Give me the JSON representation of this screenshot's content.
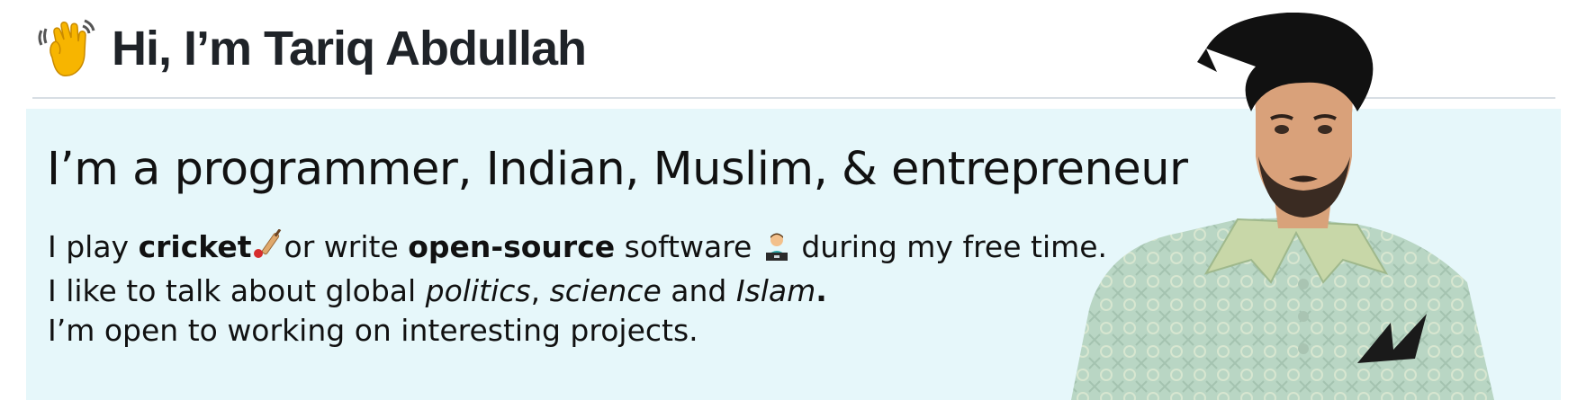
{
  "header": {
    "wave_icon": "waving-hand-icon",
    "title": "Hi, I’m Tariq Abdullah"
  },
  "intro": {
    "headline": "I’m a programmer, Indian, Muslim, & entrepreneur",
    "line1": {
      "part1": "I play ",
      "cricket": "cricket",
      "cricket_icon": "cricket-bat-icon",
      "part2": "or write ",
      "open_source": "open-source",
      "part3": " software ",
      "coder_icon": "technologist-icon",
      "part4": " during my free time."
    },
    "line2": {
      "part1": "I like to talk about global ",
      "politics": "politics",
      "comma": ", ",
      "science": "science",
      "and": " and ",
      "islam": "Islam",
      "period": "."
    },
    "line3": "I’m open to working on interesting projects."
  },
  "photo": {
    "subject": "portrait-photo"
  },
  "colors": {
    "panel_bg": "#e6f7fa",
    "divider": "#d8dee4",
    "title_text": "#1f2328"
  }
}
